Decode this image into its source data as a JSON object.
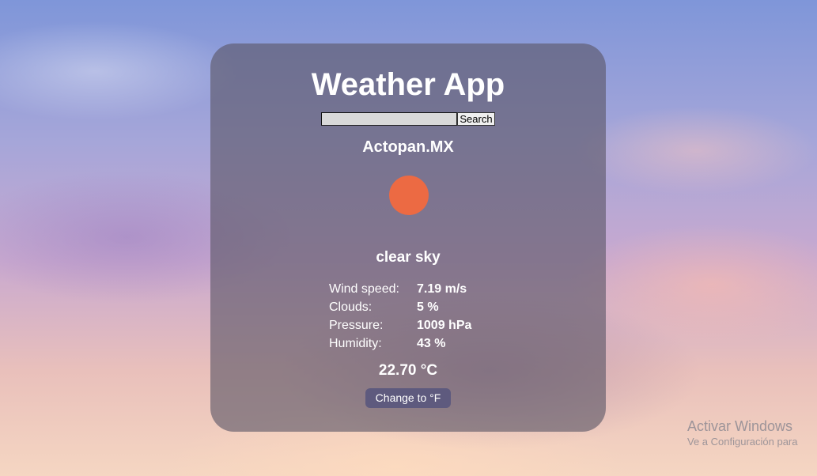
{
  "app": {
    "title": "Weather App"
  },
  "search": {
    "value": "",
    "placeholder": "",
    "button_label": "Search"
  },
  "location": {
    "city": "Actopan.MX"
  },
  "weather": {
    "icon": "sun-icon",
    "icon_color": "#ec6a43",
    "description": "clear sky",
    "temperature": "22.70 °C"
  },
  "stats": [
    {
      "label": "Wind speed:",
      "value": "7.19 m/s"
    },
    {
      "label": "Clouds:",
      "value": "5 %"
    },
    {
      "label": "Pressure:",
      "value": "1009 hPa"
    },
    {
      "label": "Humidity:",
      "value": "43 %"
    }
  ],
  "unit_toggle": {
    "label": "Change to °F"
  },
  "watermark": {
    "title": "Activar Windows",
    "subtitle": "Ve a Configuración para"
  }
}
